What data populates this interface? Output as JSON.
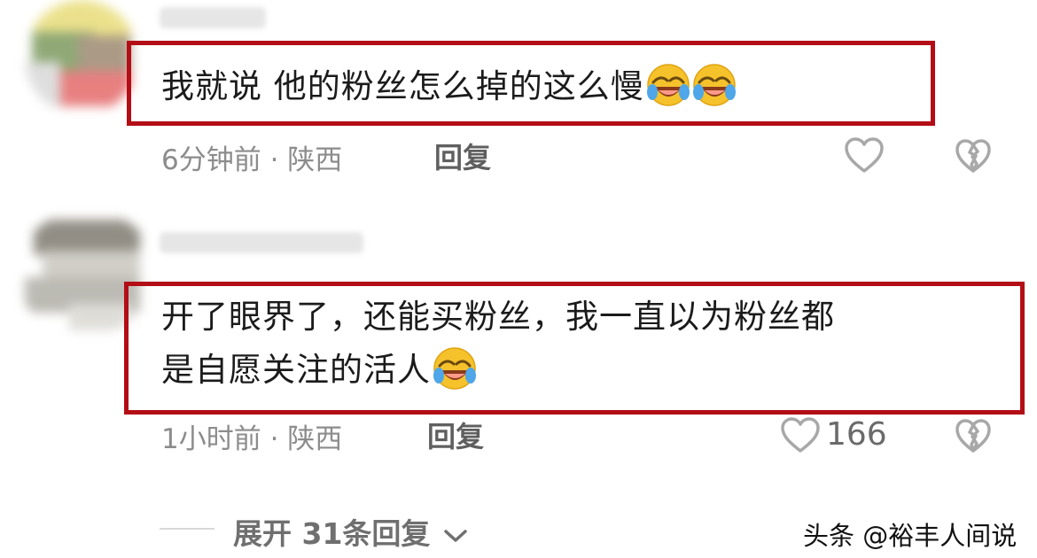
{
  "comments": [
    {
      "text_lines": [
        "我就说 他的粉丝怎么掉的这么慢"
      ],
      "emoji_count": 2,
      "time_location": "6分钟前 · 陕西",
      "reply_label": "回复",
      "like_count": ""
    },
    {
      "text_lines": [
        "开了眼界了，还能买粉丝，我一直以为粉丝都",
        "是自愿关注的活人"
      ],
      "emoji_count": 1,
      "time_location": "1小时前 · 陕西",
      "reply_label": "回复",
      "like_count": "166"
    }
  ],
  "expand": {
    "label": "展开 31条回复"
  },
  "watermark": "头条 @裕丰人间说",
  "colors": {
    "highlight_border": "#b30d16",
    "meta_text": "#8c8c8c",
    "body_text": "#1b1b1b"
  },
  "icons": [
    "heart-outline-icon",
    "broken-heart-icon",
    "chevron-down-icon",
    "laughing-tears-emoji"
  ]
}
